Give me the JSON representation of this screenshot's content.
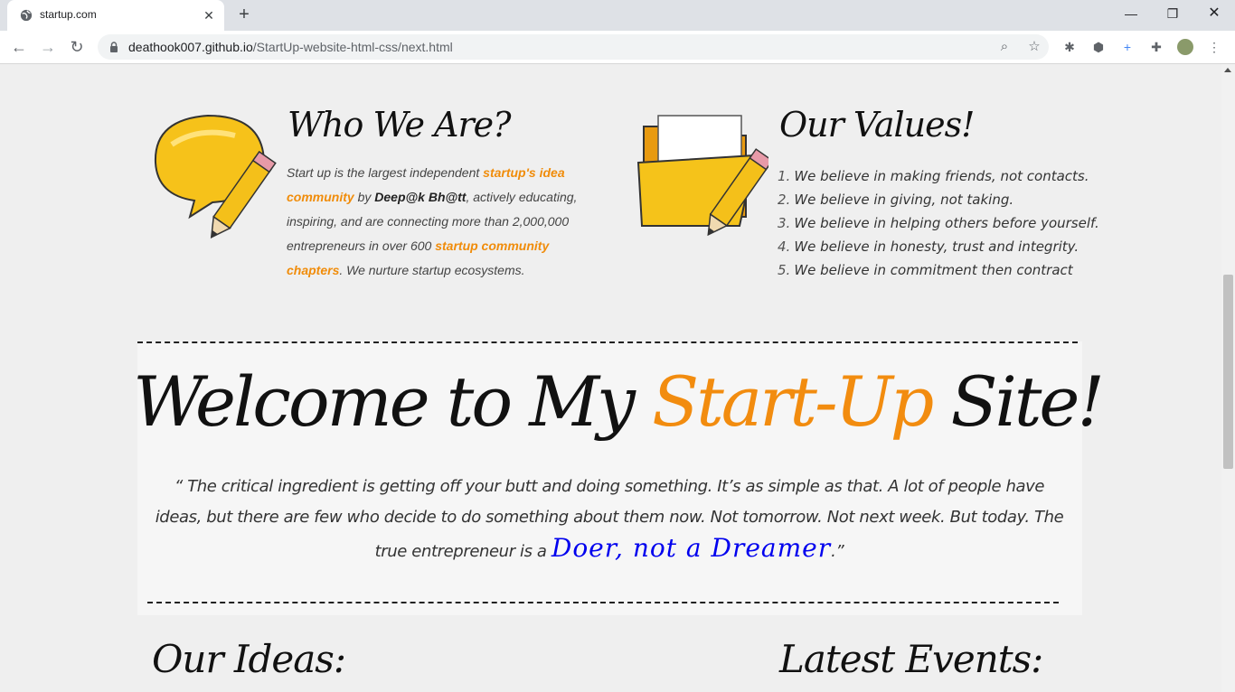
{
  "browser": {
    "tab_title": "startup.com",
    "url_domain": "deathook007.github.io",
    "url_path": "/StartUp-website-html-css/next.html"
  },
  "who": {
    "heading": "Who We Are?",
    "t1": "Start up is the largest independent ",
    "h1": "startup's idea community",
    "t2": " by ",
    "name": "Deep@k Bh@tt",
    "t3": ", actively educating, inspiring, and are connecting more than 2,000,000 entrepreneurs in over 600 ",
    "h2": "startup community chapters",
    "t4": ". We nurture startup ecosystems."
  },
  "values": {
    "heading": "Our Values!",
    "items": [
      {
        "num": "1.",
        "text": "We believe in making friends, not contacts."
      },
      {
        "num": "2.",
        "text": "We believe in giving, not taking."
      },
      {
        "num": "3.",
        "text": "We believe in helping others before yourself."
      },
      {
        "num": "4.",
        "text": "We believe in honesty, trust and integrity."
      },
      {
        "num": "5.",
        "text": "We believe in commitment then contract"
      }
    ]
  },
  "welcome": {
    "pre": "Welcome to My ",
    "accent": "Start-Up",
    "post": " Site!",
    "quote_open": "“",
    "quote_text": " The critical ingredient is getting off your butt and doing something. It’s as simple as that. A lot of people have ideas, but there are few who decide to do something about them now. Not tomorrow. Not next week. But today. The true entrepreneur is a ",
    "doer": "Doer, not a Dreamer",
    "quote_close": ".”"
  },
  "ideas": {
    "heading": "Our Ideas:"
  },
  "events": {
    "heading": "Latest Events:"
  },
  "colors": {
    "accent": "#f28c0f",
    "link_blue": "#0000ee",
    "page_bg": "#efefef"
  }
}
